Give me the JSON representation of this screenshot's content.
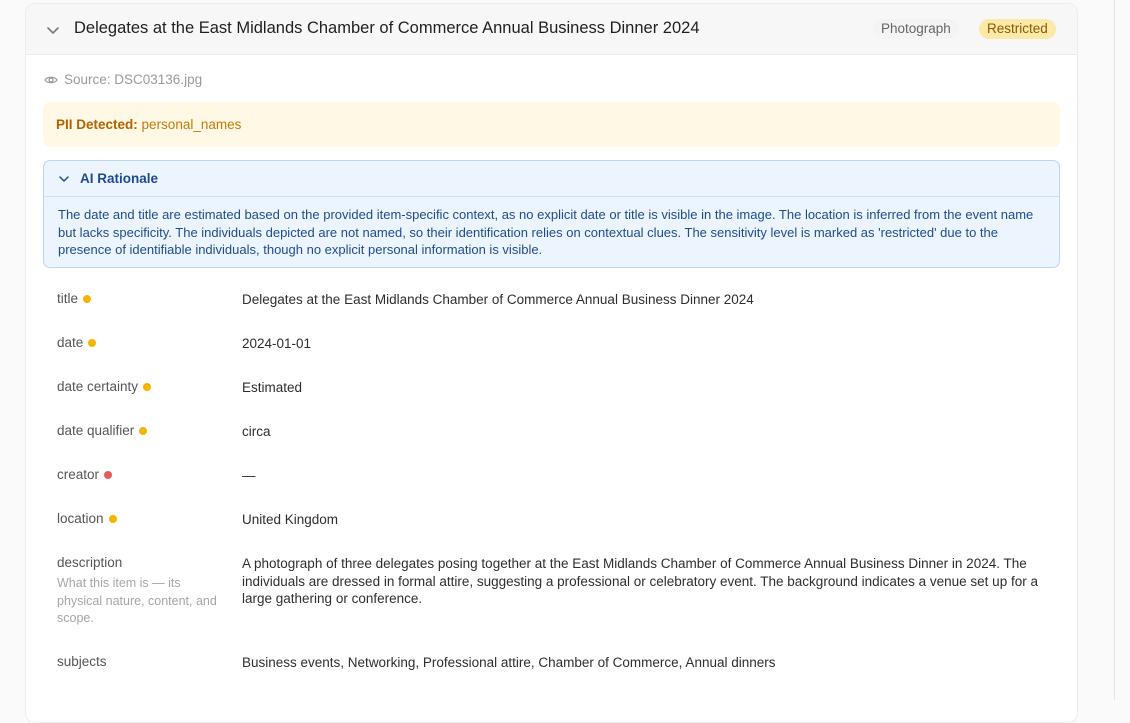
{
  "item": {
    "title": "Delegates at the East Midlands Chamber of Commerce Annual Business Dinner 2024",
    "type_badge": "Photograph",
    "sensitivity_badge": "Restricted",
    "source_label": "Source: DSC03136.jpg"
  },
  "pii": {
    "label": "PII Detected:",
    "value": "personal_names"
  },
  "rationale": {
    "heading": "AI Rationale",
    "text": "The date and title are estimated based on the provided item-specific context, as no explicit date or title is visible in the image. The location is inferred from the event name but lacks specificity. The individuals depicted are not named, so their identification relies on contextual clues. The sensitivity level is marked as 'restricted' due to the presence of identifiable individuals, though no explicit personal information is visible."
  },
  "fields": [
    {
      "label": "title",
      "status": "yellow",
      "value": "Delegates at the East Midlands Chamber of Commerce Annual Business Dinner 2024"
    },
    {
      "label": "date",
      "status": "yellow",
      "value": "2024-01-01"
    },
    {
      "label": "date certainty",
      "status": "yellow",
      "value": "Estimated"
    },
    {
      "label": "date qualifier",
      "status": "yellow",
      "value": "circa"
    },
    {
      "label": "creator",
      "status": "red",
      "value": "—"
    },
    {
      "label": "location",
      "status": "yellow",
      "value": "United Kingdom"
    },
    {
      "label": "description",
      "hint": "What this item is — its physical nature, content, and scope.",
      "value": "A photograph of three delegates posing together at the East Midlands Chamber of Commerce Annual Business Dinner in 2024. The individuals are dressed in formal attire, suggesting a professional or celebratory event. The background indicates a venue set up for a large gathering or conference."
    },
    {
      "label": "subjects",
      "value": "Business events, Networking, Professional attire, Chamber of Commerce, Annual dinners"
    }
  ],
  "colors": {
    "status_yellow": "#f2b600",
    "status_red": "#e55b5b",
    "restricted_badge": "#fbe9a8",
    "pii_background": "#fef8e4",
    "rationale_background": "#ecf4fd"
  }
}
